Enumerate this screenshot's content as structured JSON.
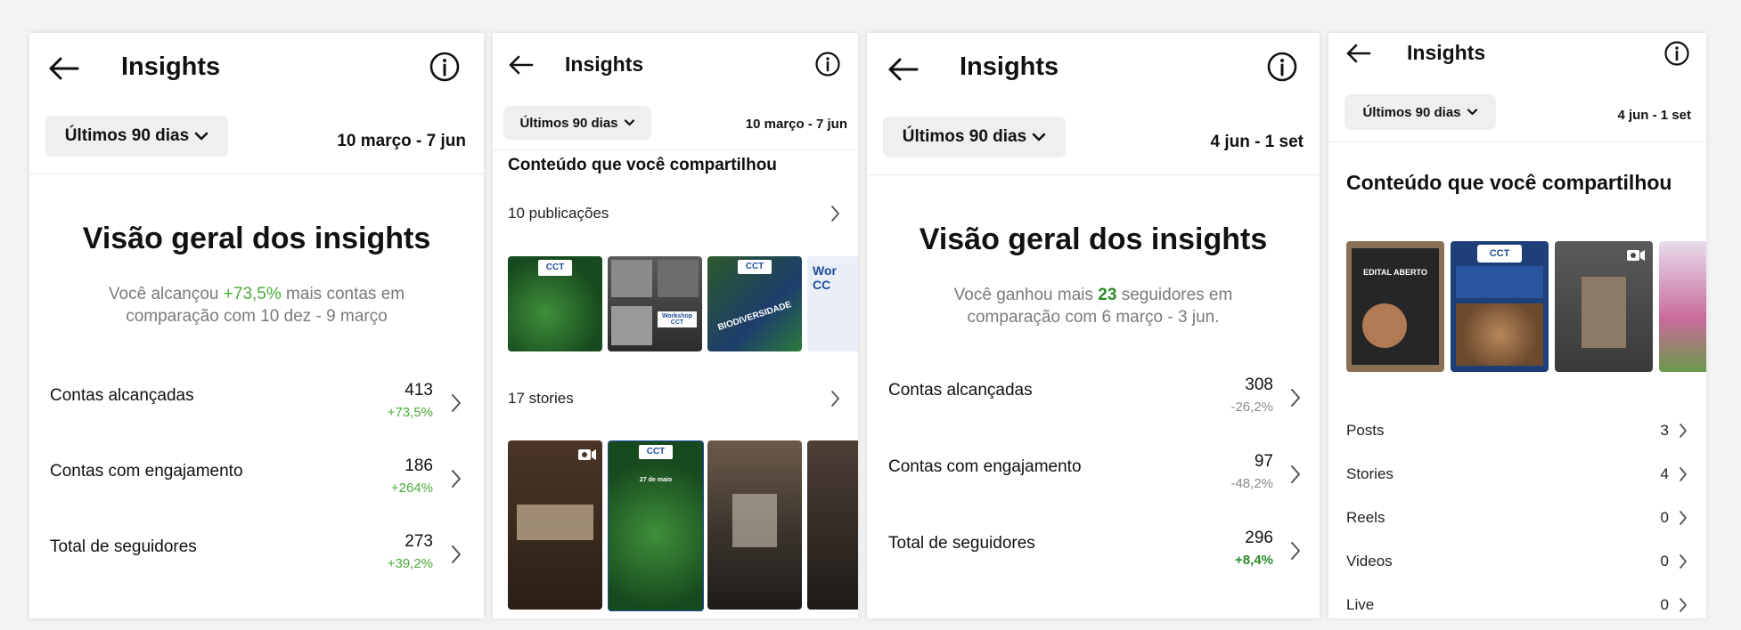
{
  "panel1": {
    "title": "Insights",
    "period_filter": "Últimos 90 dias",
    "date_range": "10 março - 7 jun",
    "overview_title": "Visão geral dos insights",
    "summary_prefix": "Você alcançou ",
    "summary_highlight": "+73,5%",
    "summary_middle": " mais contas em",
    "summary_line2": "comparação com 10 dez - 9 março",
    "metrics": [
      {
        "label": "Contas alcançadas",
        "value": "413",
        "change": "+73,5%"
      },
      {
        "label": "Contas com engajamento",
        "value": "186",
        "change": "+264%"
      },
      {
        "label": "Total de seguidores",
        "value": "273",
        "change": "+39,2%"
      }
    ]
  },
  "panel2": {
    "title": "Insights",
    "period_filter": "Últimos 90 dias",
    "date_range": "10 março - 7 jun",
    "section_title": "Conteúdo que você compartilhou",
    "publications_label": "10 publicações",
    "stories_label": "17 stories",
    "pub_thumbs": [
      {
        "caption": "CCT",
        "overlay": ""
      },
      {
        "caption": "",
        "overlay": "Workshop CCT"
      },
      {
        "caption": "CCT",
        "overlay": "BIODIVERSIDADE"
      },
      {
        "caption": "",
        "overlay": "Wor CC"
      }
    ],
    "story_thumbs": [
      {
        "caption": "",
        "overlay": ""
      },
      {
        "caption": "CCT",
        "overlay": "27 de maio"
      },
      {
        "caption": "",
        "overlay": ""
      },
      {
        "caption": "",
        "overlay": ""
      }
    ]
  },
  "panel3": {
    "title": "Insights",
    "period_filter": "Últimos 90 dias",
    "date_range": "4 jun - 1 set",
    "overview_title": "Visão geral dos insights",
    "summary_prefix": "Você ganhou mais ",
    "summary_highlight": "23",
    "summary_middle": " seguidores em",
    "summary_line2": "comparação com 6 março - 3 jun.",
    "metrics": [
      {
        "label": "Contas alcançadas",
        "value": "308",
        "change": "-26,2%"
      },
      {
        "label": "Contas com engajamento",
        "value": "97",
        "change": "-48,2%"
      },
      {
        "label": "Total de seguidores",
        "value": "296",
        "change": "+8,4%"
      }
    ]
  },
  "panel4": {
    "title": "Insights",
    "period_filter": "Últimos 90 dias",
    "date_range": "4 jun - 1 set",
    "section_title": "Conteúdo que você compartilhou",
    "thumbs": [
      {
        "caption": "EDITAL ABERTO"
      },
      {
        "caption": "CCT"
      },
      {
        "caption": ""
      },
      {
        "caption": ""
      }
    ],
    "rows": [
      {
        "label": "Posts",
        "value": "3"
      },
      {
        "label": "Stories",
        "value": "4"
      },
      {
        "label": "Reels",
        "value": "0"
      },
      {
        "label": "Videos",
        "value": "0"
      },
      {
        "label": "Live",
        "value": "0"
      }
    ]
  },
  "colors": {
    "positive": "#4caa3a",
    "positive_strong": "#2a8a2a",
    "negative": "#8a8a8a",
    "pill_bg": "#efefef"
  }
}
